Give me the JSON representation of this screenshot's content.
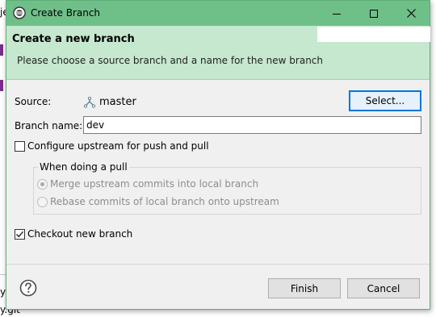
{
  "background": {
    "frag_top": "je",
    "frag_bottom_1": "y",
    "frag_bottom_2": "y.git"
  },
  "window": {
    "title": "Create Branch",
    "title_color": "#6fbf89",
    "controls": {
      "minimize": "minimize-icon",
      "maximize": "maximize-icon",
      "close": "close-icon"
    }
  },
  "banner": {
    "heading": "Create a new branch",
    "description": "Please choose a source branch and a name for the new branch",
    "color": "#c5e8cf"
  },
  "form": {
    "source_label": "Source:",
    "source_value": "master",
    "source_icon": "branch-icon",
    "select_button": "Select...",
    "branch_name_label": "Branch name:",
    "branch_name_value": "dev",
    "configure_upstream": {
      "label": "Configure upstream for push and pull",
      "checked": false
    },
    "pull_group": {
      "title": "When doing a pull",
      "options": [
        {
          "label": "Merge upstream commits into local branch",
          "selected": true,
          "enabled": false
        },
        {
          "label": "Rebase commits of local branch onto upstream",
          "selected": false,
          "enabled": false
        }
      ]
    },
    "checkout": {
      "label": "Checkout new branch",
      "checked": true
    }
  },
  "footer": {
    "help_icon": "help-icon",
    "finish_button": "Finish",
    "cancel_button": "Cancel"
  }
}
